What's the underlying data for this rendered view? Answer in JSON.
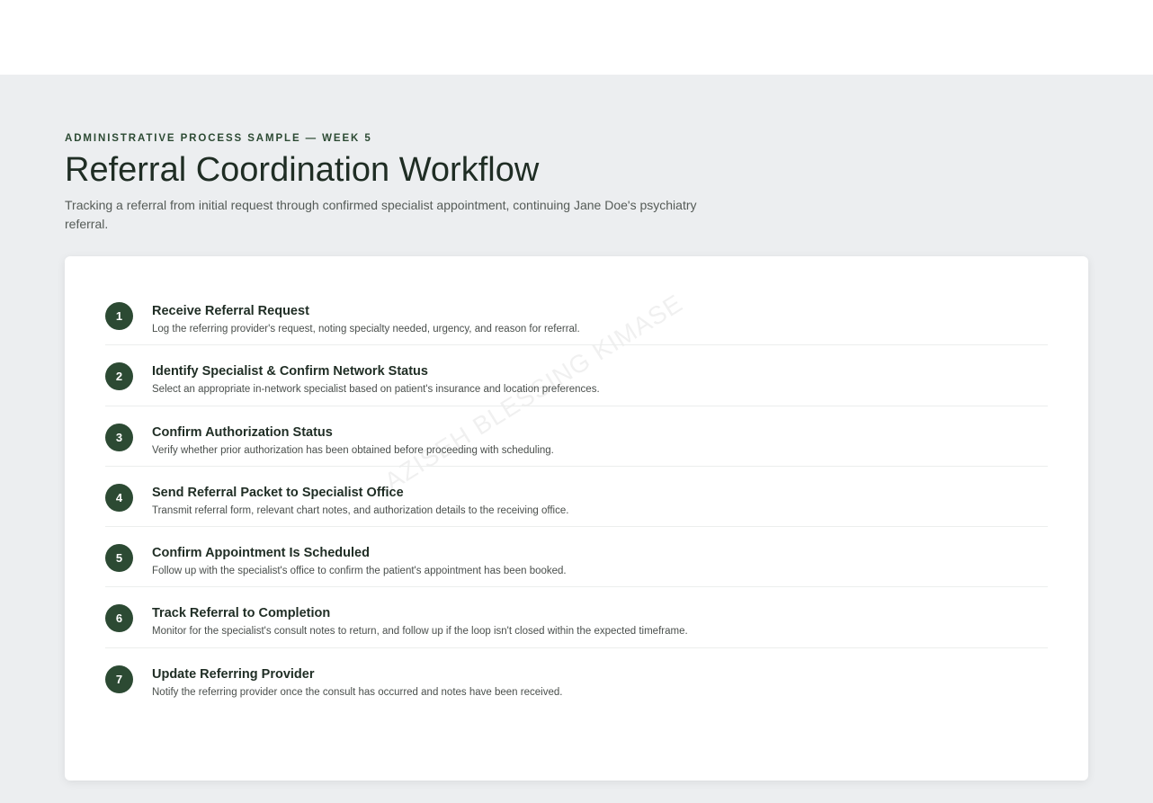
{
  "header": {
    "eyebrow": "ADMINISTRATIVE PROCESS SAMPLE — WEEK 5",
    "title": "Referral Coordination Workflow",
    "subtitle": "Tracking a referral from initial request through confirmed specialist appointment, continuing Jane Doe's psychiatry referral."
  },
  "watermark": "AZISEH BLESSING KIMASE",
  "steps": [
    {
      "number": "1",
      "title": "Receive Referral Request",
      "description": "Log the referring provider's request, noting specialty needed, urgency, and reason for referral."
    },
    {
      "number": "2",
      "title": "Identify Specialist & Confirm Network Status",
      "description": "Select an appropriate in-network specialist based on patient's insurance and location preferences."
    },
    {
      "number": "3",
      "title": "Confirm Authorization Status",
      "description": "Verify whether prior authorization has been obtained before proceeding with scheduling."
    },
    {
      "number": "4",
      "title": "Send Referral Packet to Specialist Office",
      "description": "Transmit referral form, relevant chart notes, and authorization details to the receiving office."
    },
    {
      "number": "5",
      "title": "Confirm Appointment Is Scheduled",
      "description": "Follow up with the specialist's office to confirm the patient's appointment has been booked."
    },
    {
      "number": "6",
      "title": "Track Referral to Completion",
      "description": "Monitor for the specialist's consult notes to return, and follow up if the loop isn't closed within the expected timeframe."
    },
    {
      "number": "7",
      "title": "Update Referring Provider",
      "description": "Notify the referring provider once the consult has occurred and notes have been received."
    }
  ],
  "colors": {
    "accent": "#2c4a33",
    "page_background": "#eceef0",
    "card_background": "#ffffff"
  }
}
